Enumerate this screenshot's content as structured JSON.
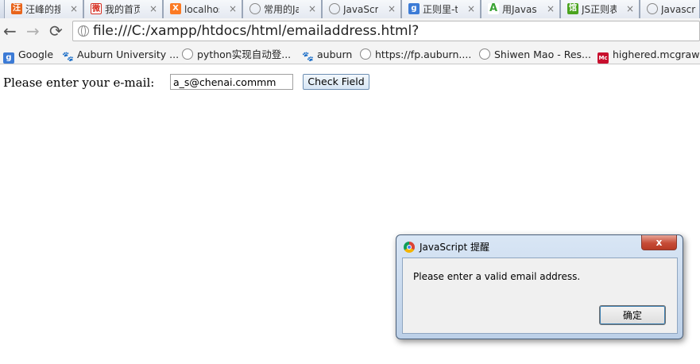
{
  "tabs": [
    {
      "label": "汪峰的搜",
      "icon": "orange-site-icon",
      "color": "#e8641b"
    },
    {
      "label": "我的首页",
      "icon": "weibo-icon",
      "color": "#d52b1e"
    },
    {
      "label": "localhos",
      "icon": "xampp-icon",
      "color": "#fb7a24"
    },
    {
      "label": "常用的Ja",
      "icon": "globe-icon",
      "color": "#888888"
    },
    {
      "label": "JavaScrip",
      "icon": "globe-icon",
      "color": "#888888"
    },
    {
      "label": "正则里-t",
      "icon": "google-icon",
      "color": "#3c7bd6"
    },
    {
      "label": "用Javasc",
      "icon": "green-a-icon",
      "color": "#3aa335"
    },
    {
      "label": "JS正则表",
      "icon": "green-site-icon",
      "color": "#4aa31e"
    },
    {
      "label": "Javascrip",
      "icon": "globe-icon",
      "color": "#888888"
    }
  ],
  "toolbar": {
    "back": "←",
    "forward": "→",
    "reload": "⟳",
    "url": "file:///C:/xampp/htdocs/html/emailaddress.html?"
  },
  "bookmarks": [
    {
      "label": "Google",
      "icon": "google-icon"
    },
    {
      "label": "Auburn University ...",
      "icon": "paw-icon"
    },
    {
      "label": "python实现自动登...",
      "icon": "globe-icon"
    },
    {
      "label": "auburn",
      "icon": "paw-icon"
    },
    {
      "label": "https://fp.auburn....",
      "icon": "globe-icon"
    },
    {
      "label": "Shiwen Mao - Res...",
      "icon": "globe-icon"
    },
    {
      "label": "highered.mcgraw-...",
      "icon": "mcgraw-icon"
    }
  ],
  "page": {
    "prompt_label": "Please enter your e-mail:",
    "email_value": "a_s@chenai.commm",
    "check_button": "Check Field"
  },
  "dialog": {
    "title": "JavaScript 提醒",
    "close": "x",
    "message": "Please enter a valid email address.",
    "ok": "确定"
  },
  "colors": {
    "tab_border": "#9aa6b8",
    "dialog_frame": "#bcd0e8",
    "close_button": "#c64c37"
  }
}
